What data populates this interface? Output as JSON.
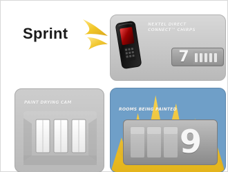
{
  "logo": {
    "brand": "Sprint",
    "mark_color": "#f0c21a"
  },
  "tiles": {
    "chirps": {
      "title_line1": "NEXTEL DIRECT",
      "title_line2": "CONNECT™ CHIRPS",
      "value": "7",
      "colors": {
        "bg": "#c8c8c8",
        "counter": "#9a9a9a"
      }
    },
    "cam": {
      "title": "PAINT DRYING CAM",
      "colors": {
        "bg": "#c0c0c0"
      }
    },
    "rooms": {
      "title": "ROOMS BEING PAINTED",
      "value": "9",
      "colors": {
        "bg": "#6f9fc8",
        "burst": "#f4c21b",
        "counter": "#a8a8a8"
      }
    }
  },
  "icons": {
    "phone": "phone-icon",
    "logo_mark": "sprint-wing-logo"
  }
}
